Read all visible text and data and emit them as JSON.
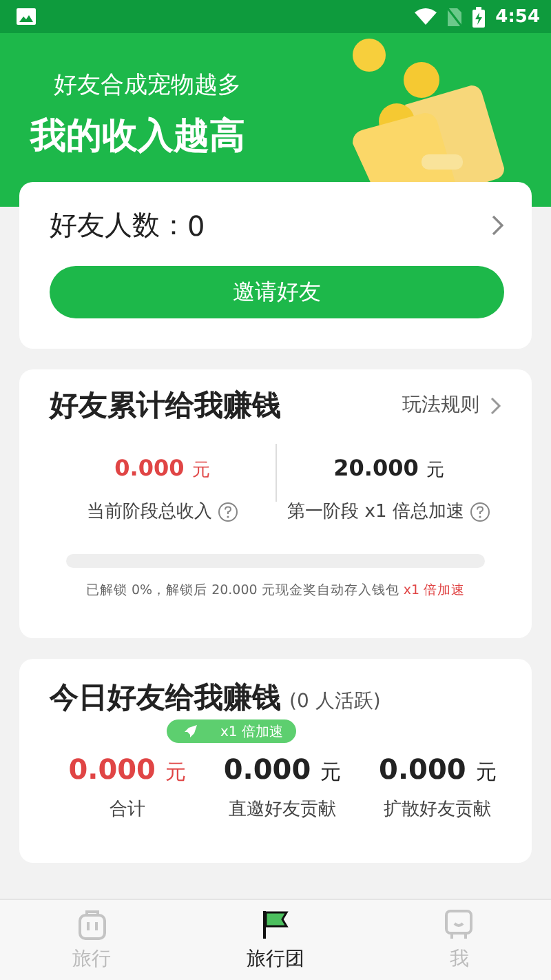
{
  "status_bar": {
    "time": "4:54"
  },
  "header": {
    "subtitle": "好友合成宠物越多",
    "title": "我的收入越高"
  },
  "friends_card": {
    "label": "好友人数：",
    "count": "0",
    "invite_button": "邀请好友"
  },
  "earnings_card": {
    "title": "好友累计给我赚钱",
    "rules_link": "玩法规则",
    "stats": [
      {
        "amount": "0.000",
        "unit": "元",
        "label": "当前阶段总收入",
        "highlight": true
      },
      {
        "amount": "20.000",
        "unit": "元",
        "label": "第一阶段 x1 倍总加速",
        "highlight": false
      }
    ],
    "progress": {
      "level": 0
    },
    "note": "已解锁 0%，解锁后 20.000 元现金奖自动存入钱包",
    "note_highlight": "x1 倍加速"
  },
  "today_card": {
    "title": "今日好友给我赚钱",
    "active": "(0 人活跃)",
    "badge": "x1 倍加速",
    "stats": [
      {
        "amount": "0.000",
        "unit": "元",
        "label": "合计",
        "highlight": true
      },
      {
        "amount": "0.000",
        "unit": "元",
        "label": "直邀好友贡献",
        "highlight": false
      },
      {
        "amount": "0.000",
        "unit": "元",
        "label": "扩散好友贡献",
        "highlight": false
      }
    ]
  },
  "tabs": [
    {
      "label": "旅行",
      "selected": false,
      "kind": "luggage"
    },
    {
      "label": "旅行团",
      "selected": true,
      "kind": "flag"
    },
    {
      "label": "我",
      "selected": false,
      "kind": "robot"
    }
  ]
}
